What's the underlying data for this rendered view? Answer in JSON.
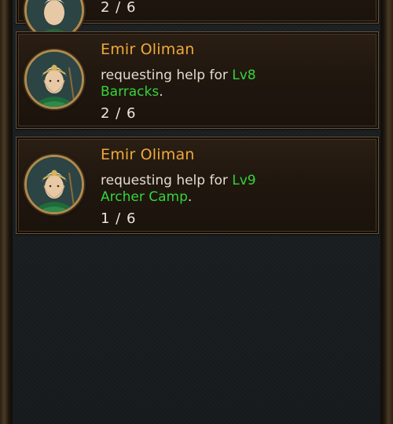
{
  "entries": [
    {
      "count": "2 / 6"
    },
    {
      "name": "Emir Oliman",
      "msg_prefix": "requesting help for ",
      "level": "Lv8",
      "building": "Barracks",
      "msg_suffix": ".",
      "count": "2 / 6",
      "avatar_icon": "hero-portrait-icon"
    },
    {
      "name": "Emir Oliman",
      "msg_prefix": "requesting help for ",
      "level": "Lv9",
      "building": "Archer Camp",
      "msg_suffix": ".",
      "count": "1 / 6",
      "avatar_icon": "hero-portrait-icon"
    }
  ],
  "colors": {
    "name": "#f0a93a",
    "highlight": "#35d43a",
    "text": "#e3dccf",
    "card_border": "#6b5233"
  }
}
